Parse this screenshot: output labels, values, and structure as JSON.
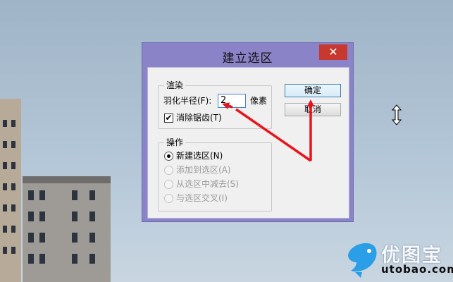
{
  "dialog": {
    "title": "建立选区",
    "close_glyph": "✕",
    "render_group": {
      "legend": "渲染",
      "feather_label": "羽化半径(F):",
      "feather_value": "2",
      "feather_unit": "像素",
      "antialias_check": "✔",
      "antialias_label": "消除锯齿(T)"
    },
    "operation_group": {
      "legend": "操作",
      "options": [
        {
          "label": "新建选区(N)",
          "checked": true,
          "enabled": true
        },
        {
          "label": "添加到选区(A)",
          "checked": false,
          "enabled": false
        },
        {
          "label": "从选区中减去(S)",
          "checked": false,
          "enabled": false
        },
        {
          "label": "与选区交叉(I)",
          "checked": false,
          "enabled": false
        }
      ]
    },
    "ok_label": "确定",
    "cancel_label": "取消"
  },
  "annotation_color": "#e8141b",
  "watermark": {
    "name_cn": "优图宝",
    "domain": "utobao.com",
    "brand_color": "#2a9ee6"
  },
  "cursor": "vertical-resize-cursor"
}
